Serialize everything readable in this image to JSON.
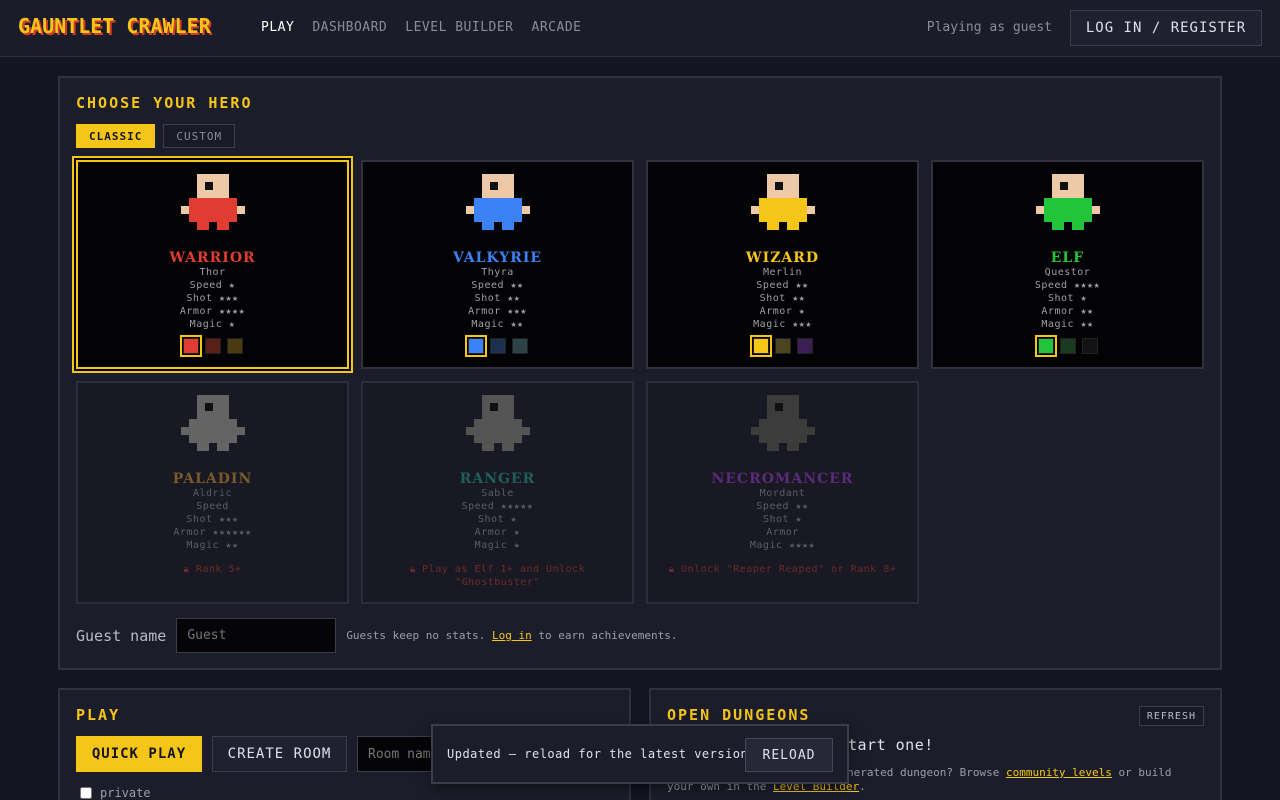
{
  "header": {
    "logo": "GAUNTLET CRAWLER",
    "nav": [
      "PLAY",
      "DASHBOARD",
      "LEVEL BUILDER",
      "ARCADE"
    ],
    "active_nav": "PLAY",
    "guest_status": "Playing as guest",
    "login_label": "LOG IN / REGISTER"
  },
  "hero_panel": {
    "title": "CHOOSE YOUR HERO",
    "tabs": [
      "CLASSIC",
      "CUSTOM"
    ],
    "active_tab": "CLASSIC"
  },
  "heroes": [
    {
      "name": "WARRIOR",
      "alias": "Thor",
      "speed": "Speed ★",
      "shot": "Shot ★★★",
      "armor": "Armor ★★★★",
      "magic": "Magic ★",
      "color": "#e03c31",
      "swatches": [
        "#e03c31",
        "#5a1f18",
        "#4a3a10"
      ],
      "selected_swatch": 0,
      "selected": true,
      "locked": false
    },
    {
      "name": "VALKYRIE",
      "alias": "Thyra",
      "speed": "Speed ★★",
      "shot": "Shot ★★",
      "armor": "Armor ★★★",
      "magic": "Magic ★★",
      "color": "#3b82f6",
      "swatches": [
        "#3b82f6",
        "#1e3050",
        "#2c4448"
      ],
      "selected_swatch": 0,
      "selected": false,
      "locked": false
    },
    {
      "name": "WIZARD",
      "alias": "Merlin",
      "speed": "Speed ★★",
      "shot": "Shot ★★",
      "armor": "Armor ★",
      "magic": "Magic ★★★",
      "color": "#f5c518",
      "swatches": [
        "#f5c518",
        "#4a4420",
        "#3a1f55"
      ],
      "selected_swatch": 0,
      "selected": false,
      "locked": false
    },
    {
      "name": "ELF",
      "alias": "Questor",
      "speed": "Speed ★★★★",
      "shot": "Shot ★",
      "armor": "Armor ★★",
      "magic": "Magic ★★",
      "color": "#22c53a",
      "swatches": [
        "#22c53a",
        "#1a3a1f",
        "#121212"
      ],
      "selected_swatch": 0,
      "selected": false,
      "locked": false
    },
    {
      "name": "PALADIN",
      "alias": "Aldric",
      "speed": "Speed",
      "shot": "Shot ★★★",
      "armor": "Armor ★★★★★★",
      "magic": "Magic ★★",
      "color": "#7a5a2a",
      "lock_text": "Rank 5+",
      "selected": false,
      "locked": true
    },
    {
      "name": "RANGER",
      "alias": "Sable",
      "speed": "Speed ★★★★★",
      "shot": "Shot ★",
      "armor": "Armor ★",
      "magic": "Magic ★",
      "color": "#1f5e5a",
      "lock_text": "Play as Elf 1+ and Unlock \"Ghostbuster\"",
      "selected": false,
      "locked": true
    },
    {
      "name": "NECROMANCER",
      "alias": "Mordant",
      "speed": "Speed ★★",
      "shot": "Shot ★",
      "armor": "Armor",
      "magic": "Magic ★★★★",
      "color": "#5b2a7a",
      "lock_text": "Unlock \"Reaper Reaped\" or Rank 8+",
      "selected": false,
      "locked": true
    }
  ],
  "guest": {
    "label": "Guest name",
    "placeholder": "Guest",
    "hint_before": "Guests keep no stats. ",
    "hint_link": "Log in",
    "hint_after": " to earn achievements."
  },
  "play": {
    "title": "PLAY",
    "quick_play": "QUICK PLAY",
    "create_room": "CREATE ROOM",
    "room_placeholder": "Room name",
    "private_label": "private"
  },
  "dungeons": {
    "title": "OPEN DUNGEONS",
    "refresh": "REFRESH",
    "big_text_tail": "tart one!",
    "text_visible_start": "nerated dungeon? Browse ",
    "link_community": "community levels",
    "text_middle": " or build",
    "text_line2_start": "your own in the ",
    "link_builder": "Level Builder",
    "text_end": "."
  },
  "toast": {
    "message": "Updated — reload for the latest version.",
    "button": "RELOAD"
  }
}
